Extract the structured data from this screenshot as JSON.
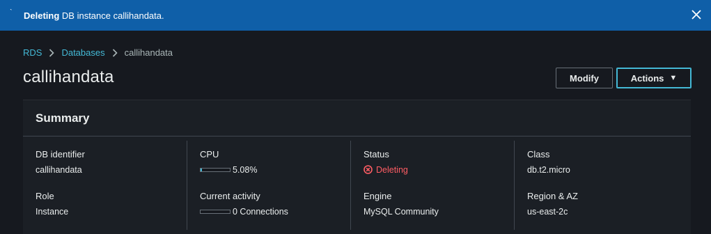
{
  "flash": {
    "strong": "Deleting",
    "message": " DB instance callihandata."
  },
  "breadcrumb": {
    "items": [
      "RDS",
      "Databases"
    ],
    "current": "callihandata"
  },
  "page": {
    "title": "callihandata",
    "modify_label": "Modify",
    "actions_label": "Actions"
  },
  "summary": {
    "title": "Summary",
    "db_identifier": {
      "label": "DB identifier",
      "value": "callihandata"
    },
    "role": {
      "label": "Role",
      "value": "Instance"
    },
    "cpu": {
      "label": "CPU",
      "value": "5.08%",
      "fraction": 0.0508
    },
    "activity": {
      "label": "Current activity",
      "value": "0 Connections",
      "fraction": 0
    },
    "status": {
      "label": "Status",
      "value": "Deleting",
      "color": "#ff5d64"
    },
    "engine": {
      "label": "Engine",
      "value": "MySQL Community"
    },
    "class": {
      "label": "Class",
      "value": "db.t2.micro"
    },
    "region": {
      "label": "Region & AZ",
      "value": "us-east-2c"
    }
  },
  "colors": {
    "flash_bg": "#0f5fa8",
    "link": "#44b9d6",
    "error": "#ff5d64"
  }
}
